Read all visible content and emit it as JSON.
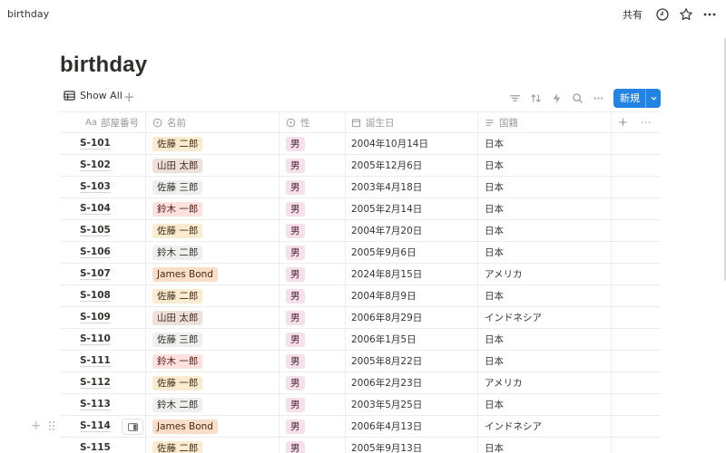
{
  "topbar": {
    "breadcrumb": "birthday",
    "share_label": "共有",
    "icons": [
      "history-icon",
      "star-icon",
      "more-icon"
    ]
  },
  "page": {
    "title": "birthday"
  },
  "view": {
    "tab_label": "Show All",
    "add_view": "+",
    "tools": [
      "filter-icon",
      "sort-icon",
      "automation-icon",
      "search-icon",
      "more-icon"
    ],
    "new_label": "新規",
    "new_dropdown_icon": "chevron-down-icon"
  },
  "table": {
    "columns": [
      {
        "key": "id",
        "label": "部屋番号",
        "type_icon": "Aa"
      },
      {
        "key": "name",
        "label": "名前",
        "type_icon": "select-icon"
      },
      {
        "key": "sex",
        "label": "性",
        "type_icon": "select-icon"
      },
      {
        "key": "date",
        "label": "誕生日",
        "type_icon": "calendar-icon"
      },
      {
        "key": "nat",
        "label": "国籍",
        "type_icon": "text-icon"
      }
    ],
    "add_column": "+",
    "more_column": "···",
    "rows": [
      {
        "id": "S-101",
        "name": "佐藤 二郎",
        "name_color": "yellow",
        "sex": "男",
        "date": "2004年10月14日",
        "nat": "日本"
      },
      {
        "id": "S-102",
        "name": "山田 太郎",
        "name_color": "brown",
        "sex": "男",
        "date": "2005年12月6日",
        "nat": "日本"
      },
      {
        "id": "S-103",
        "name": "佐藤 三郎",
        "name_color": "gray",
        "sex": "男",
        "date": "2003年4月18日",
        "nat": "日本"
      },
      {
        "id": "S-104",
        "name": "鈴木 一郎",
        "name_color": "red",
        "sex": "男",
        "date": "2005年2月14日",
        "nat": "日本"
      },
      {
        "id": "S-105",
        "name": "佐藤 一郎",
        "name_color": "yellow",
        "sex": "男",
        "date": "2004年7月20日",
        "nat": "日本"
      },
      {
        "id": "S-106",
        "name": "鈴木 二郎",
        "name_color": "gray",
        "sex": "男",
        "date": "2005年9月6日",
        "nat": "日本"
      },
      {
        "id": "S-107",
        "name": "James Bond",
        "name_color": "orange",
        "sex": "男",
        "date": "2024年8月15日",
        "nat": "アメリカ"
      },
      {
        "id": "S-108",
        "name": "佐藤 二郎",
        "name_color": "yellow",
        "sex": "男",
        "date": "2004年8月9日",
        "nat": "日本"
      },
      {
        "id": "S-109",
        "name": "山田 太郎",
        "name_color": "brown",
        "sex": "男",
        "date": "2006年8月29日",
        "nat": "インドネシア"
      },
      {
        "id": "S-110",
        "name": "佐藤 三郎",
        "name_color": "gray",
        "sex": "男",
        "date": "2006年1月5日",
        "nat": "日本"
      },
      {
        "id": "S-111",
        "name": "鈴木 一郎",
        "name_color": "red",
        "sex": "男",
        "date": "2005年8月22日",
        "nat": "日本"
      },
      {
        "id": "S-112",
        "name": "佐藤 一郎",
        "name_color": "yellow",
        "sex": "男",
        "date": "2006年2月23日",
        "nat": "アメリカ"
      },
      {
        "id": "S-113",
        "name": "鈴木 二郎",
        "name_color": "gray",
        "sex": "男",
        "date": "2003年5月25日",
        "nat": "日本"
      },
      {
        "id": "S-114",
        "name": "James Bond",
        "name_color": "orange",
        "sex": "男",
        "date": "2006年4月13日",
        "nat": "インドネシア",
        "hovered": true
      },
      {
        "id": "S-115",
        "name": "佐藤 二郎",
        "name_color": "yellow",
        "sex": "男",
        "date": "2005年9月13日",
        "nat": "日本"
      }
    ]
  },
  "colors": {
    "accent": "#2383e2",
    "text": "#37352f",
    "muted": "#9b9a97",
    "border": "#ededec"
  }
}
